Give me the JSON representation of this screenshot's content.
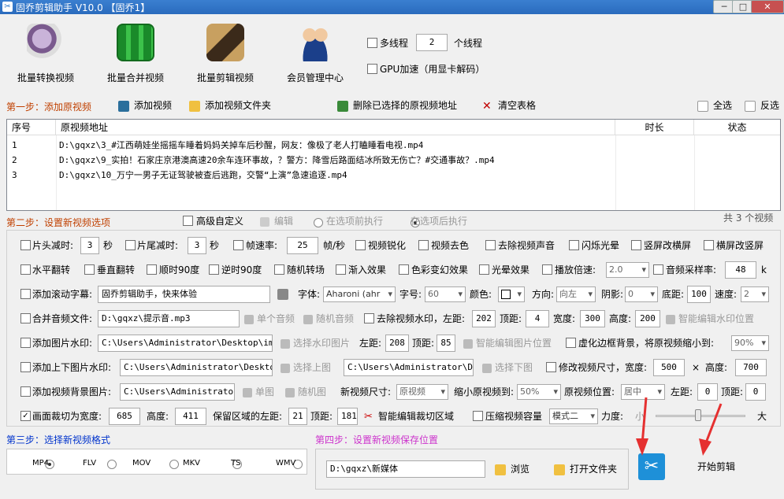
{
  "window": {
    "title": "固乔剪辑助手 V10.0 【固乔1】"
  },
  "toolbar": {
    "items": [
      {
        "label": "批量转换视频",
        "icon": "film-reel-icon"
      },
      {
        "label": "批量合并视频",
        "icon": "film-strip-green-icon"
      },
      {
        "label": "批量剪辑视频",
        "icon": "film-scissors-icon"
      },
      {
        "label": "会员管理中心",
        "icon": "users-icon"
      }
    ],
    "multithread_label": "多线程",
    "thread_count": "2",
    "thread_unit": "个线程",
    "gpu_label": "GPU加速（用显卡解码）"
  },
  "step1": {
    "title": "第一步：添加原视频",
    "add_video": "添加视频",
    "add_folder": "添加视频文件夹",
    "delete_selected": "删除已选择的原视频地址",
    "clear_table": "清空表格",
    "select_all": "全选",
    "invert": "反选"
  },
  "table": {
    "columns": [
      "序号",
      "原视频地址",
      "时长",
      "状态"
    ],
    "rows": [
      {
        "no": "1",
        "path": "D:\\gqxz\\3_#江西萌娃坐摇摇车睡着妈妈关掉车后秒醒，网友：像极了老人打瞌睡看电视.mp4"
      },
      {
        "no": "2",
        "path": "D:\\gqxz\\9_实拍！石家庄京港澳高速20余车连环事故，？警方：降雪后路面结冰所致无伤亡？#交通事故？.mp4"
      },
      {
        "no": "3",
        "path": "D:\\gqxz\\10_万宁一男子无证驾驶被查后逃跑，交警“上演”急速追逐.mp4"
      }
    ],
    "total": "共 3 个视频"
  },
  "step2": {
    "title": "第二步：设置新视频选项",
    "advanced": "高级自定义",
    "edit": "编辑",
    "before": "在选项前执行",
    "after": "在选项后执行"
  },
  "options": {
    "r1": {
      "head_cut": "片头减时:",
      "head_val": "3",
      "sec": "秒",
      "tail_cut": "片尾减时:",
      "tail_val": "3",
      "sec2": "秒",
      "fps": "帧速率:",
      "fps_val": "25",
      "fps_unit": "帧/秒",
      "sharpen": "视频锐化",
      "desat": "视频去色",
      "mute": "去除视频声音",
      "flash": "闪烁光晕",
      "v2h": "竖屏改横屏",
      "h2v": "横屏改竖屏"
    },
    "r2": {
      "hflip": "水平翻转",
      "vflip": "垂直翻转",
      "cw90": "顺时90度",
      "ccw90": "逆时90度",
      "rand": "随机转场",
      "fadein": "渐入效果",
      "colorfx": "色彩变幻效果",
      "halo": "光晕效果",
      "speed": "播放倍速:",
      "speed_val": "2.0",
      "samplerate": "音频采样率:",
      "samplerate_val": "48",
      "k": "k"
    },
    "r3": {
      "marquee": "添加滚动字幕:",
      "marquee_text": "固乔剪辑助手，快来体验",
      "font": "字体:",
      "font_val": "Aharoni (ahr",
      "size": "字号:",
      "size_val": "60",
      "color": "颜色:",
      "dir": "方向:",
      "dir_val": "向左",
      "shadow": "阴影:",
      "shadow_val": "0",
      "bottom": "底距:",
      "bottom_val": "100",
      "spd": "速度:",
      "spd_val": "2"
    },
    "r4": {
      "merge_audio": "合并音频文件:",
      "audio_path": "D:\\gqxz\\提示音.mp3",
      "single": "单个音频",
      "random": "随机音频",
      "rm_wm": "去除视频水印，左距:",
      "left_val": "202",
      "top": "顶距:",
      "top_val": "4",
      "width": "宽度:",
      "width_val": "300",
      "height": "高度:",
      "height_val": "200",
      "smart_wm": "智能编辑水印位置"
    },
    "r5": {
      "img_wm": "添加图片水印:",
      "img_path": "C:\\Users\\Administrator\\Desktop\\img-q",
      "choose_img": "选择水印图片",
      "left": "左距:",
      "left_val": "208",
      "top": "顶距:",
      "top_val": "85",
      "smart_img": "智能编辑图片位置",
      "blur_bg": "虚化边框背景，将原视频缩小到:",
      "scale_val": "90%"
    },
    "r6": {
      "updown": "添加上下图片水印:",
      "up_path": "C:\\Users\\Administrator\\Desktop\\i",
      "choose_up": "选择上图",
      "down_path": "C:\\Users\\Administrator\\Desk",
      "choose_down": "选择下图",
      "resize": "修改视频尺寸，宽度:",
      "w_val": "500",
      "x": "×",
      "h": "高度:",
      "h_val": "700"
    },
    "r7": {
      "bg_img": "添加视频背景图片:",
      "bg_path": "C:\\Users\\Administrator\\D",
      "single": "单图",
      "random": "随机图",
      "newsize": "新视频尺寸:",
      "newsize_val": "原视频",
      "shrink": "缩小原视频到:",
      "shrink_val": "50%",
      "pos": "原视频位置:",
      "pos_val": "居中",
      "left": "左距:",
      "left_val": "0",
      "top": "顶距:",
      "top_val": "0"
    },
    "r8": {
      "crop": "画面裁切为宽度:",
      "crop_w": "685",
      "h": "高度:",
      "crop_h": "411",
      "keep_left": "保留区域的左距:",
      "left_val": "21",
      "top": "顶距:",
      "top_val": "181",
      "smart_crop": "智能编辑裁切区域",
      "compress": "压缩视频容量",
      "mode_val": "模式二",
      "strength": "力度:",
      "small": "小",
      "big": "大"
    }
  },
  "step3": {
    "title": "第三步：选择新视频格式",
    "formats": [
      "MP4",
      "FLV",
      "MOV",
      "MKV",
      "TS",
      "WMV"
    ],
    "selected": "MP4"
  },
  "step4": {
    "title": "第四步：设置新视频保存位置",
    "path": "D:\\gqxz\\新媒体",
    "browse": "浏览",
    "open_folder": "打开文件夹"
  },
  "start": {
    "label": "开始剪辑"
  },
  "colors": {
    "title_bar": "#2a6bbd",
    "step1": "#c04000",
    "step3": "#0033cc",
    "step4": "#cc33cc",
    "arrow": "#e53030",
    "start_icon": "#1e90d8"
  }
}
